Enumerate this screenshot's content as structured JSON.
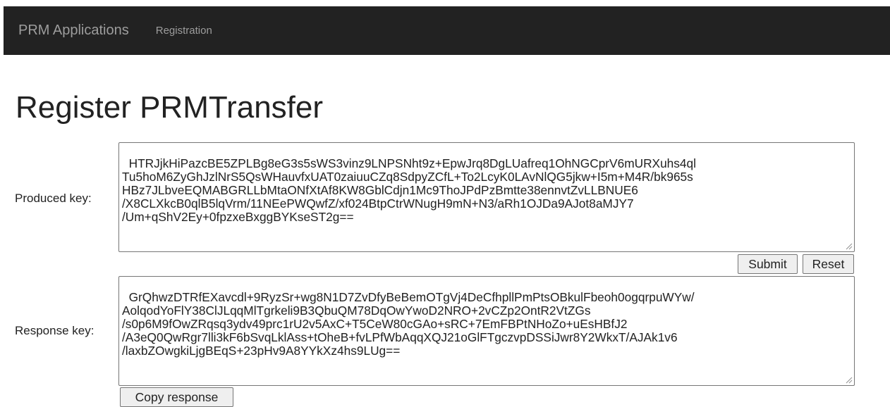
{
  "navbar": {
    "brand": "PRM Applications",
    "link_registration": "Registration"
  },
  "page": {
    "title": "Register PRMTransfer"
  },
  "produced": {
    "label": "Produced key:",
    "value": "HTRJjkHiPazcBE5ZPLBg8eG3s5sWS3vinz9LNPSNht9z+EpwJrq8DgLUafreq1OhNGCprV6mURXuhs4ql\nTu5hoM6ZyGhJzlNrS5QsWHauvfxUAT0zaiuuCZq8SdpyZCfL+To2LcyK0LAvNlQG5jkw+I5m+M4R/bk965s\nHBz7JLbveEQMABGRLLbMtaONfXtAf8KW8GblCdjn1Mc9ThoJPdPzBmtte38ennvtZvLLBNUE6\n/X8CLXkcB0qlB5lqVrm/11NEePWQwfZ/xf024BtpCtrWNugH9mN+N3/aRh1OJDa9AJot8aMJY7\n/Um+qShV2Ey+0fpzxeBxggBYKseST2g=="
  },
  "buttons": {
    "submit": "Submit",
    "reset": "Reset",
    "copy_response": "Copy response"
  },
  "response": {
    "label": "Response key:",
    "value": "GrQhwzDTRfEXavcdl+9RyzSr+wg8N1D7ZvDfyBeBemOTgVj4DeCfhpllPmPtsOBkulFbeoh0ogqrpuWYw/\nAolqodYoFlY38ClJLqqMlTgrkeli9B3QbuQM78DqOwYwoD2NRO+2vCZp2OntR2VtZGs\n/s0p6M9fOwZRqsq3ydv49prc1rU2v5AxC+T5CeW80cGAo+sRC+7EmFBPtNHoZo+uEsHBfJ2\n/A3eQ0QwRgr7lli3kF6bSvqLklAss+tOheB+fvLPfWbAqqXQJ21oGlFTgczvpDSSiJwr8Y2WkxT/AJAk1v6\n/laxbZOwgkiLjgBEqS+23pHv9A8YYkXz4hs9LUg=="
  }
}
